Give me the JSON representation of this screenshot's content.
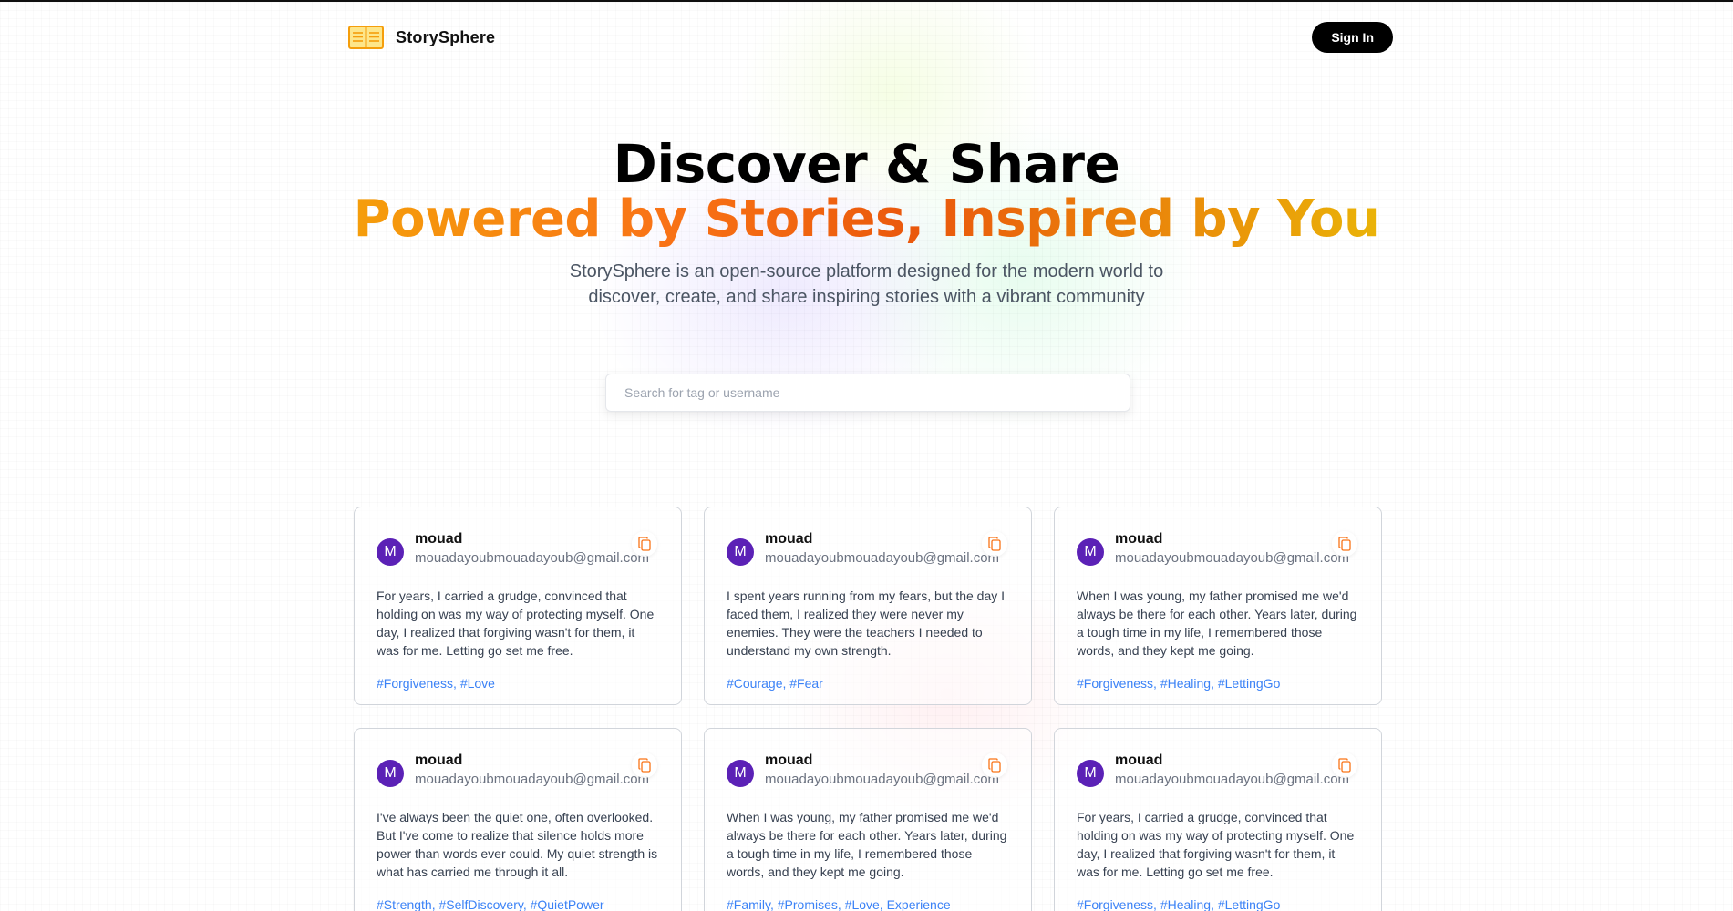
{
  "nav": {
    "brand": "StorySphere",
    "signin_label": "Sign In"
  },
  "hero": {
    "title": "Discover & Share",
    "subtitle": "Powered by Stories, Inspired by You",
    "description": "StorySphere is an open-source platform designed for the modern world to discover, create, and share inspiring stories with a vibrant community"
  },
  "search": {
    "placeholder": "Search for tag or username",
    "value": ""
  },
  "colors": {
    "accent_orange": "#f97316",
    "avatar": "#5b21b6",
    "tag": "#3b82f6",
    "button": "#000000"
  },
  "posts": [
    {
      "avatar_letter": "M",
      "username": "mouad",
      "email": "mouadayoubmouadayoub@gmail.com",
      "text": "For years, I carried a grudge, convinced that holding on was my way of protecting myself. One day, I realized that forgiving wasn't for them, it was for me. Letting go set me free.",
      "tags": "#Forgiveness, #Love"
    },
    {
      "avatar_letter": "M",
      "username": "mouad",
      "email": "mouadayoubmouadayoub@gmail.com",
      "text": "I spent years running from my fears, but the day I faced them, I realized they were never my enemies. They were the teachers I needed to understand my own strength.",
      "tags": "#Courage, #Fear"
    },
    {
      "avatar_letter": "M",
      "username": "mouad",
      "email": "mouadayoubmouadayoub@gmail.com",
      "text": "When I was young, my father promised me we'd always be there for each other. Years later, during a tough time in my life, I remembered those words, and they kept me going.",
      "tags": "#Forgiveness, #Healing, #LettingGo"
    },
    {
      "avatar_letter": "M",
      "username": "mouad",
      "email": "mouadayoubmouadayoub@gmail.com",
      "text": "I've always been the quiet one, often overlooked. But I've come to realize that silence holds more power than words ever could. My quiet strength is what has carried me through it all.",
      "tags": "#Strength, #SelfDiscovery, #QuietPower"
    },
    {
      "avatar_letter": "M",
      "username": "mouad",
      "email": "mouadayoubmouadayoub@gmail.com",
      "text": "When I was young, my father promised me we'd always be there for each other. Years later, during a tough time in my life, I remembered those words, and they kept me going.",
      "tags": "#Family, #Promises, #Love, Experience"
    },
    {
      "avatar_letter": "M",
      "username": "mouad",
      "email": "mouadayoubmouadayoub@gmail.com",
      "text": "For years, I carried a grudge, convinced that holding on was my way of protecting myself. One day, I realized that forgiving wasn't for them, it was for me. Letting go set me free.",
      "tags": "#Forgiveness, #Healing, #LettingGo"
    }
  ]
}
